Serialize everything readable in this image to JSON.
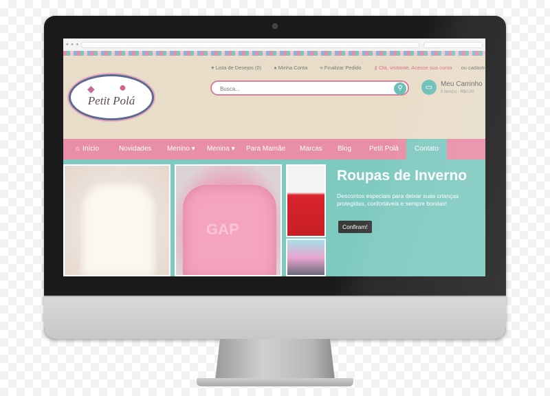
{
  "top_links": {
    "wishlist": "Lista de Desejos (0)",
    "account": "Minha Conta",
    "checkout": "Finalizar Pedido",
    "greeting": "Olá, visitante. Acesse sua conta",
    "register": "ou cadastre-se"
  },
  "logo": {
    "text": "Petit Polá"
  },
  "search": {
    "placeholder": "Busca..."
  },
  "cart": {
    "title": "Meu Carrinho",
    "subtitle": "0 item(s) - R$0,00"
  },
  "nav": {
    "items": [
      {
        "label": "Início"
      },
      {
        "label": "Novidades"
      },
      {
        "label": "Menino ▾"
      },
      {
        "label": "Menina ▾"
      },
      {
        "label": "Para Mamãe"
      },
      {
        "label": "Marcas"
      },
      {
        "label": "Blog"
      },
      {
        "label": "Petit Polá"
      },
      {
        "label": "Contato"
      }
    ]
  },
  "hero": {
    "title": "Roupas de Inverno",
    "text": "Descontos especiais para deixar suas crianças protegidas, confortáveis e sempre bonitas!",
    "button": "Confiram!"
  },
  "product_labels": {
    "gap": "GAP"
  },
  "colors": {
    "nav_pink": "#e88ea7",
    "accent_teal": "#7ec9c0",
    "header_beige": "#e8ddc9",
    "monitor_bezel": "#1b1b1b"
  }
}
